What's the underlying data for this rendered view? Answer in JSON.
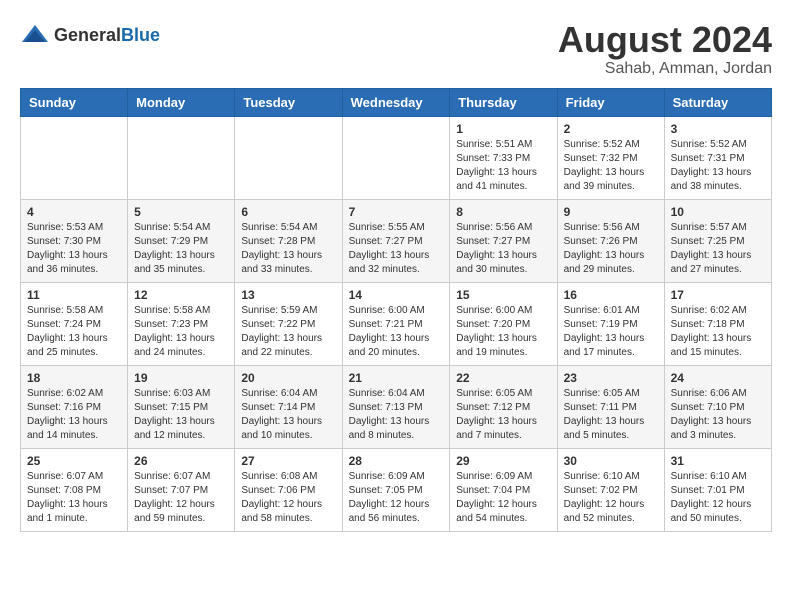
{
  "header": {
    "logo": {
      "general": "General",
      "blue": "Blue"
    },
    "title": "August 2024",
    "location": "Sahab, Amman, Jordan"
  },
  "days_of_week": [
    "Sunday",
    "Monday",
    "Tuesday",
    "Wednesday",
    "Thursday",
    "Friday",
    "Saturday"
  ],
  "weeks": [
    [
      {
        "day": "",
        "info": ""
      },
      {
        "day": "",
        "info": ""
      },
      {
        "day": "",
        "info": ""
      },
      {
        "day": "",
        "info": ""
      },
      {
        "day": "1",
        "sunrise": "5:51 AM",
        "sunset": "7:33 PM",
        "daylight": "13 hours and 41 minutes."
      },
      {
        "day": "2",
        "sunrise": "5:52 AM",
        "sunset": "7:32 PM",
        "daylight": "13 hours and 39 minutes."
      },
      {
        "day": "3",
        "sunrise": "5:52 AM",
        "sunset": "7:31 PM",
        "daylight": "13 hours and 38 minutes."
      }
    ],
    [
      {
        "day": "4",
        "sunrise": "5:53 AM",
        "sunset": "7:30 PM",
        "daylight": "13 hours and 36 minutes."
      },
      {
        "day": "5",
        "sunrise": "5:54 AM",
        "sunset": "7:29 PM",
        "daylight": "13 hours and 35 minutes."
      },
      {
        "day": "6",
        "sunrise": "5:54 AM",
        "sunset": "7:28 PM",
        "daylight": "13 hours and 33 minutes."
      },
      {
        "day": "7",
        "sunrise": "5:55 AM",
        "sunset": "7:27 PM",
        "daylight": "13 hours and 32 minutes."
      },
      {
        "day": "8",
        "sunrise": "5:56 AM",
        "sunset": "7:27 PM",
        "daylight": "13 hours and 30 minutes."
      },
      {
        "day": "9",
        "sunrise": "5:56 AM",
        "sunset": "7:26 PM",
        "daylight": "13 hours and 29 minutes."
      },
      {
        "day": "10",
        "sunrise": "5:57 AM",
        "sunset": "7:25 PM",
        "daylight": "13 hours and 27 minutes."
      }
    ],
    [
      {
        "day": "11",
        "sunrise": "5:58 AM",
        "sunset": "7:24 PM",
        "daylight": "13 hours and 25 minutes."
      },
      {
        "day": "12",
        "sunrise": "5:58 AM",
        "sunset": "7:23 PM",
        "daylight": "13 hours and 24 minutes."
      },
      {
        "day": "13",
        "sunrise": "5:59 AM",
        "sunset": "7:22 PM",
        "daylight": "13 hours and 22 minutes."
      },
      {
        "day": "14",
        "sunrise": "6:00 AM",
        "sunset": "7:21 PM",
        "daylight": "13 hours and 20 minutes."
      },
      {
        "day": "15",
        "sunrise": "6:00 AM",
        "sunset": "7:20 PM",
        "daylight": "13 hours and 19 minutes."
      },
      {
        "day": "16",
        "sunrise": "6:01 AM",
        "sunset": "7:19 PM",
        "daylight": "13 hours and 17 minutes."
      },
      {
        "day": "17",
        "sunrise": "6:02 AM",
        "sunset": "7:18 PM",
        "daylight": "13 hours and 15 minutes."
      }
    ],
    [
      {
        "day": "18",
        "sunrise": "6:02 AM",
        "sunset": "7:16 PM",
        "daylight": "13 hours and 14 minutes."
      },
      {
        "day": "19",
        "sunrise": "6:03 AM",
        "sunset": "7:15 PM",
        "daylight": "13 hours and 12 minutes."
      },
      {
        "day": "20",
        "sunrise": "6:04 AM",
        "sunset": "7:14 PM",
        "daylight": "13 hours and 10 minutes."
      },
      {
        "day": "21",
        "sunrise": "6:04 AM",
        "sunset": "7:13 PM",
        "daylight": "13 hours and 8 minutes."
      },
      {
        "day": "22",
        "sunrise": "6:05 AM",
        "sunset": "7:12 PM",
        "daylight": "13 hours and 7 minutes."
      },
      {
        "day": "23",
        "sunrise": "6:05 AM",
        "sunset": "7:11 PM",
        "daylight": "13 hours and 5 minutes."
      },
      {
        "day": "24",
        "sunrise": "6:06 AM",
        "sunset": "7:10 PM",
        "daylight": "13 hours and 3 minutes."
      }
    ],
    [
      {
        "day": "25",
        "sunrise": "6:07 AM",
        "sunset": "7:08 PM",
        "daylight": "13 hours and 1 minute."
      },
      {
        "day": "26",
        "sunrise": "6:07 AM",
        "sunset": "7:07 PM",
        "daylight": "12 hours and 59 minutes."
      },
      {
        "day": "27",
        "sunrise": "6:08 AM",
        "sunset": "7:06 PM",
        "daylight": "12 hours and 58 minutes."
      },
      {
        "day": "28",
        "sunrise": "6:09 AM",
        "sunset": "7:05 PM",
        "daylight": "12 hours and 56 minutes."
      },
      {
        "day": "29",
        "sunrise": "6:09 AM",
        "sunset": "7:04 PM",
        "daylight": "12 hours and 54 minutes."
      },
      {
        "day": "30",
        "sunrise": "6:10 AM",
        "sunset": "7:02 PM",
        "daylight": "12 hours and 52 minutes."
      },
      {
        "day": "31",
        "sunrise": "6:10 AM",
        "sunset": "7:01 PM",
        "daylight": "12 hours and 50 minutes."
      }
    ]
  ]
}
